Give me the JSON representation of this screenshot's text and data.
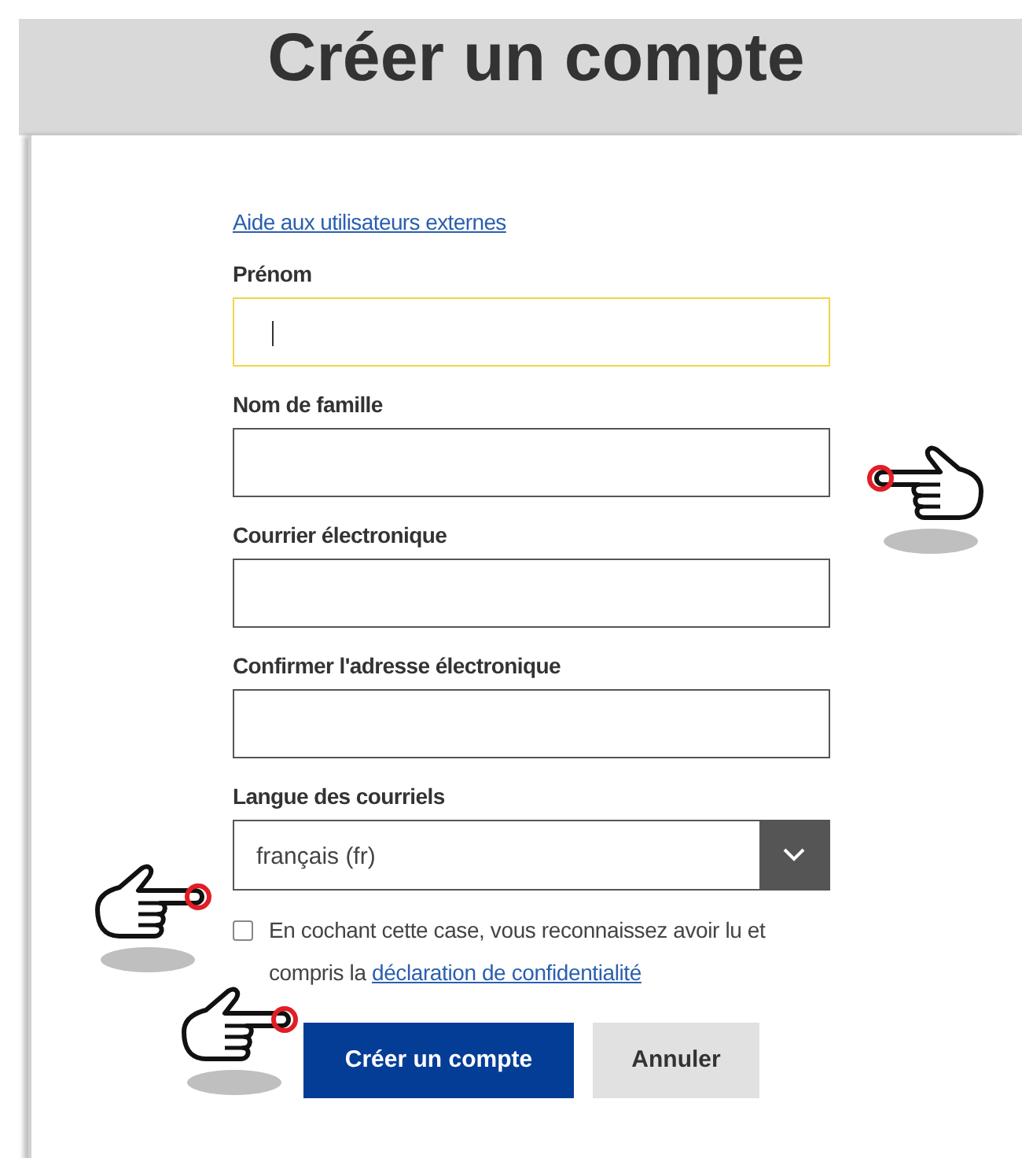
{
  "page": {
    "title": "Créer un compte"
  },
  "help_link": "Aide aux utilisateurs externes",
  "fields": [
    {
      "kind": "text",
      "label": "Prénom",
      "focused": true
    },
    {
      "kind": "text",
      "label": "Nom de famille",
      "focused": false
    },
    {
      "kind": "text",
      "label": "Courrier électronique",
      "focused": false
    },
    {
      "kind": "text",
      "label": "Confirmer l'adresse électronique",
      "focused": false
    },
    {
      "kind": "select",
      "label": "Langue des courriels",
      "value": "français (fr)",
      "focused": false
    }
  ],
  "consent": {
    "checked": false,
    "text": "En cochant cette case, vous reconnaissez avoir lu et compris la",
    "link": "déclaration de confidentialité"
  },
  "buttons": [
    {
      "kind": "primary",
      "label": "Créer un compte"
    },
    {
      "kind": "secondary",
      "label": "Annuler"
    }
  ]
}
